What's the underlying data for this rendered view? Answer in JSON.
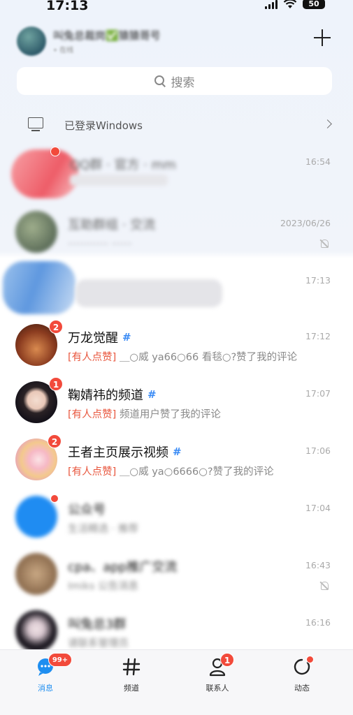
{
  "status_bar": {
    "time": "17:13",
    "battery": "50"
  },
  "header": {
    "username": "叫兔总裁岗✅猿猿哥号",
    "status": "• 在线"
  },
  "search": {
    "placeholder": "搜索"
  },
  "device_notice": {
    "label": "已登录Windows"
  },
  "conversations": [
    {
      "title": "QQ群 · 官方 · mm",
      "preview": "",
      "time": "16:54",
      "blurred": true
    },
    {
      "title": "互助群组 · 交流",
      "preview": "…………  ……",
      "time": "2023/06/26",
      "blurred": true,
      "muted": true
    },
    {
      "title": "",
      "preview": "",
      "time": "17:13",
      "blurred": true
    },
    {
      "title": "万龙觉醒",
      "tag": "[有人点赞]",
      "preview": "＿○威 ya66○66 看毯○?赞了我的评论",
      "time": "17:12",
      "badge": "2",
      "channel": true
    },
    {
      "title": "鞠婧祎的频道",
      "tag": "[有人点赞]",
      "preview": "频道用户赞了我的评论",
      "time": "17:07",
      "badge": "1",
      "channel": true
    },
    {
      "title": "王者主页展示视频",
      "tag": "[有人点赞]",
      "preview": "＿○威 ya○6666○?赞了我的评论",
      "time": "17:06",
      "badge": "2",
      "channel": true
    },
    {
      "title": "公众号",
      "preview": "生活精选 · 推荐",
      "time": "17:04",
      "blurred": true
    },
    {
      "title": "cpa、app推广交流",
      "preview": "Imiks 公告消息",
      "time": "16:43",
      "blurred": true,
      "muted": true
    },
    {
      "title": "叫兔总3群",
      "preview": "请联系管理员",
      "time": "16:16",
      "blurred": true
    }
  ],
  "tabs": [
    {
      "label": "消息",
      "badge": "99+"
    },
    {
      "label": "频道"
    },
    {
      "label": "联系人",
      "badge": "1"
    },
    {
      "label": "动态"
    }
  ]
}
